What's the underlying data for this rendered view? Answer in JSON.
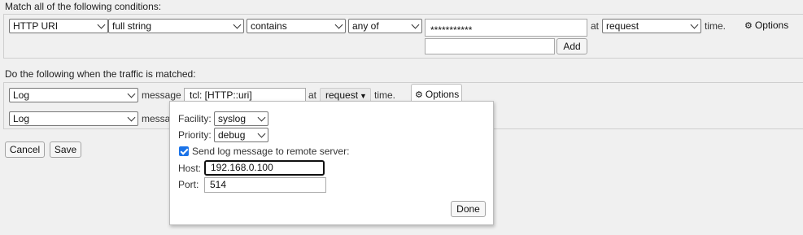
{
  "match_section": {
    "label": "Match all of the following conditions:",
    "condition": {
      "field": "HTTP URI",
      "match_type": "full string",
      "operator": "contains",
      "quantifier": "any of",
      "value": "***********",
      "new_value_placeholder": "",
      "add_label": "Add",
      "at_label": "at",
      "timing": "request",
      "time_label": "time.",
      "options_label": "Options"
    }
  },
  "action_section": {
    "label": "Do the following when the traffic is matched:",
    "actions": [
      {
        "type": "Log",
        "message_label": "message",
        "message_value": "tcl: [HTTP::uri]",
        "at_label": "at",
        "timing": "request",
        "time_label": "time.",
        "options_label": "Options"
      },
      {
        "type": "Log",
        "message_label": "messa"
      }
    ]
  },
  "buttons": {
    "cancel": "Cancel",
    "save": "Save"
  },
  "options_popup": {
    "facility_label": "Facility:",
    "facility_value": "syslog",
    "priority_label": "Priority:",
    "priority_value": "debug",
    "remote_checked": true,
    "remote_label": "Send log message to remote server:",
    "host_label": "Host:",
    "host_value": "192.168.0.100",
    "port_label": "Port:",
    "port_value": "514",
    "done_label": "Done"
  }
}
